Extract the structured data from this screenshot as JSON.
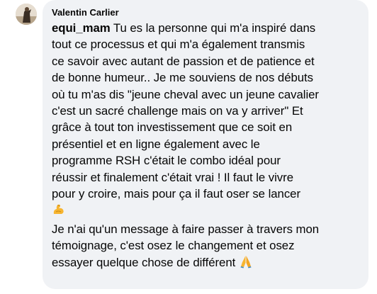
{
  "comment": {
    "author": "Valentin Carlier",
    "mention": "equi_mam",
    "lines": [
      " Tu es la personne qui m'a inspiré dans",
      "tout ce processus et qui m'a également transmis",
      "ce savoir avec autant de passion et de patience et",
      "de bonne humeur.. Je me souviens de nos débuts",
      "où tu m'as dis \"jeune cheval avec un jeune cavalier",
      "c'est un sacré challenge mais on va y arriver\" Et",
      "grâce à tout ton investissement que ce soit en",
      "présentiel et en ligne également avec le",
      "programme RSH c'était le combo idéal pour",
      "réussir et finalement c'était vrai ! Il faut le vivre",
      "pour y croire, mais pour ça il faut oser se lancer"
    ],
    "emoji_1": "flexed-biceps-emoji",
    "lines_2": [
      "Je n'ai qu'un message à faire passer à travers mon",
      "témoignage, c'est osez le changement et osez",
      "essayer quelque chose de différent "
    ],
    "emoji_2": "folded-hands-emoji"
  },
  "colors": {
    "bubble_bg": "#f0f2f5",
    "text": "#050505"
  }
}
